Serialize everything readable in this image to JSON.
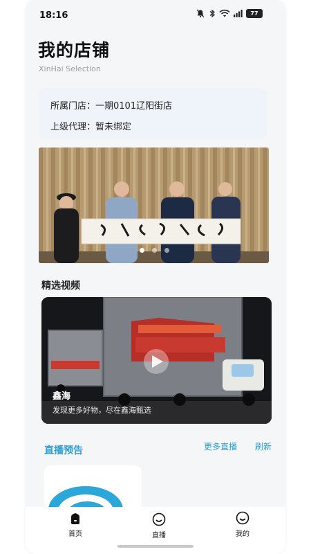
{
  "status_bar": {
    "time": "18:16",
    "battery": "77",
    "icons": [
      "mute-icon",
      "bluetooth-icon",
      "wifi-icon",
      "signal-icon",
      "battery-icon"
    ]
  },
  "header": {
    "title": "我的店铺",
    "subtitle": "XinHai Selection"
  },
  "store_info": {
    "store_label": "所属门店：",
    "store_value": "一期0101辽阳街店",
    "agent_label": "上级代理：",
    "agent_value": "暂未绑定"
  },
  "banner": {
    "slide_count": 3,
    "active_index": 0
  },
  "featured_videos": {
    "title": "精选视频",
    "video_name": "鑫海",
    "video_desc": "发现更多好物，尽在鑫海甄选"
  },
  "live_preview": {
    "title": "直播预告",
    "more_label": "更多直播",
    "refresh_label": "刷新"
  },
  "tabbar": {
    "items": [
      {
        "label": "首页",
        "icon": "home-icon",
        "active": true
      },
      {
        "label": "直播",
        "icon": "live-icon",
        "active": false
      },
      {
        "label": "我的",
        "icon": "profile-icon",
        "active": false
      }
    ]
  },
  "colors": {
    "accent": "#2a9fd6",
    "card_bg": "#eef4f9",
    "page_bg": "#f5f6f8"
  }
}
